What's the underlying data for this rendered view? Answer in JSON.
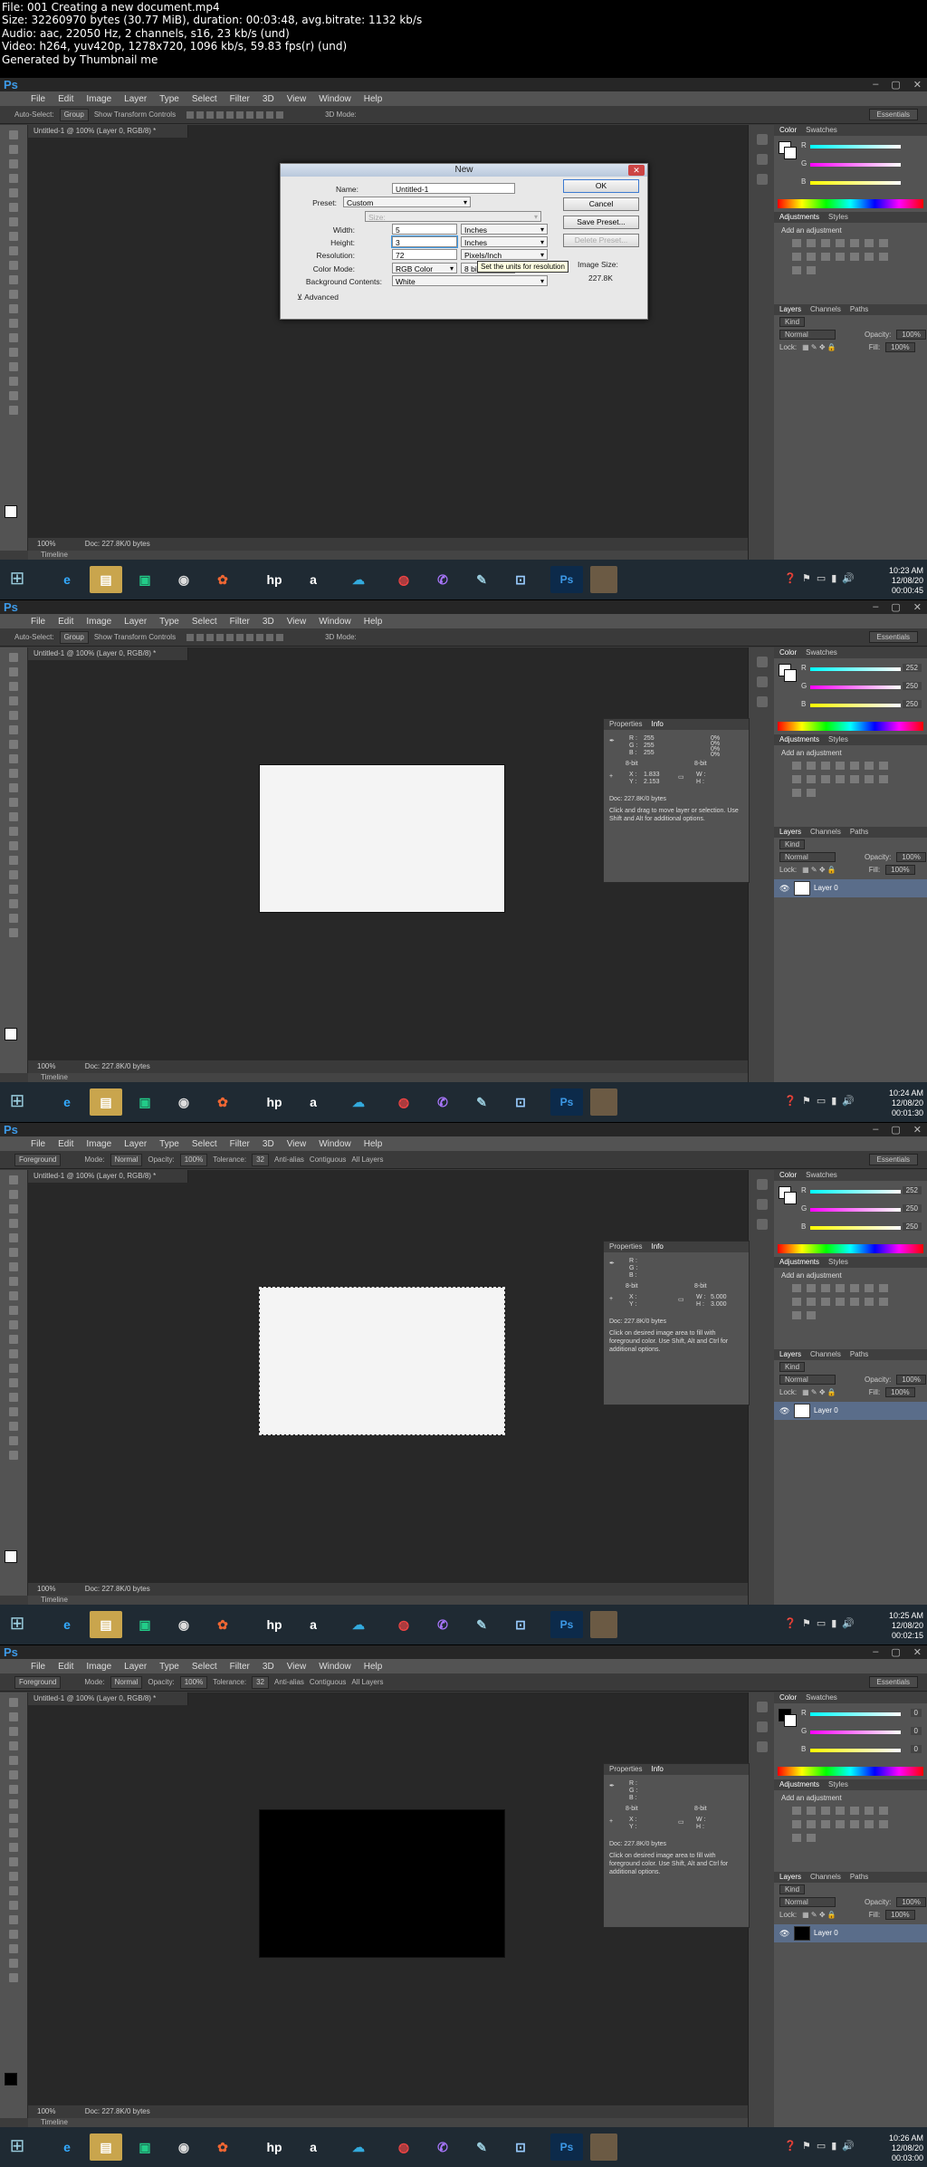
{
  "header": {
    "file": "File: 001 Creating a new document.mp4",
    "size": "Size: 32260970 bytes (30.77 MiB), duration: 00:03:48, avg.bitrate: 1132 kb/s",
    "audio": "Audio: aac, 22050 Hz, 2 channels, s16, 23 kb/s (und)",
    "video": "Video: h264, yuv420p, 1278x720, 1096 kb/s, 59.83 fps(r) (und)",
    "generator": "Generated by Thumbnail me"
  },
  "app": {
    "logo": "Ps",
    "menu": [
      "File",
      "Edit",
      "Image",
      "Layer",
      "Type",
      "Select",
      "Filter",
      "3D",
      "View",
      "Window",
      "Help"
    ],
    "workspace": "Essentials",
    "window_controls": [
      "–",
      "▢",
      "✕"
    ],
    "doc_tab": "Untitled-1 @ 100% (Layer 0, RGB/8) *",
    "status_zoom": "100%",
    "status_doc": "Doc: 227.8K/0 bytes",
    "timeline": "Timeline"
  },
  "optbar_move": {
    "auto_select": "Auto-Select:",
    "group": "Group",
    "show_transform": "Show Transform Controls",
    "mode3d": "3D Mode:"
  },
  "optbar_fill": {
    "fill": "Foreground",
    "mode_lbl": "Mode:",
    "mode": "Normal",
    "opacity_lbl": "Opacity:",
    "opacity": "100%",
    "tolerance_lbl": "Tolerance:",
    "tolerance": "32",
    "anti_alias": "Anti-alias",
    "contiguous": "Contiguous",
    "all_layers": "All Layers"
  },
  "panels": {
    "color_tabs": [
      "Color",
      "Swatches"
    ],
    "adj_tabs": [
      "Adjustments",
      "Styles"
    ],
    "adj_heading": "Add an adjustment",
    "layers_tabs": [
      "Layers",
      "Channels",
      "Paths"
    ],
    "kind": "Kind",
    "blend": "Normal",
    "opacity_lbl": "Opacity:",
    "opacity": "100%",
    "lock_lbl": "Lock:",
    "fill_lbl": "Fill:",
    "fill": "100%",
    "layer_name": "Layer 0",
    "info_tabs": [
      "Properties",
      "Info"
    ]
  },
  "frames": [
    {
      "timestamp": "00:00:45",
      "clock": "10:23 AM",
      "date": "12/08/20",
      "rgb": [
        "R",
        "G",
        "B"
      ],
      "rgb_vals": [
        "",
        "",
        ""
      ],
      "dialog": {
        "title": "New",
        "name_lbl": "Name:",
        "name": "Untitled-1",
        "preset_lbl": "Preset:",
        "preset": "Custom",
        "size_lbl": "Size:",
        "width_lbl": "Width:",
        "width": "5",
        "width_unit": "Inches",
        "height_lbl": "Height:",
        "height": "3",
        "height_unit": "Inches",
        "res_lbl": "Resolution:",
        "res": "72",
        "res_unit": "Pixels/Inch",
        "mode_lbl": "Color Mode:",
        "mode": "RGB Color",
        "bits": "8 bit",
        "bg_lbl": "Background Contents:",
        "bg": "White",
        "advanced": "Advanced",
        "ok": "OK",
        "cancel": "Cancel",
        "save_preset": "Save Preset...",
        "delete_preset": "Delete Preset...",
        "image_size_lbl": "Image Size:",
        "image_size": "227.8K",
        "tooltip": "Set the units for resolution"
      }
    },
    {
      "timestamp": "00:01:30",
      "clock": "10:24 AM",
      "date": "12/08/20",
      "rgb_vals": [
        "252",
        "250",
        "250"
      ],
      "info": {
        "r": "255",
        "g": "255",
        "b": "255",
        "c": "0%",
        "m": "0%",
        "y": "0%",
        "k": "0%",
        "bits": "8-bit",
        "x": "1.833",
        "yv": "2.153",
        "doc": "Doc: 227.8K/0 bytes",
        "hint": "Click and drag to move layer or selection. Use Shift and Alt for additional options."
      }
    },
    {
      "timestamp": "00:02:15",
      "clock": "10:25 AM",
      "date": "12/08/20",
      "rgb_vals": [
        "252",
        "250",
        "250"
      ],
      "info": {
        "w": "5.000",
        "h": "3.000",
        "bits": "8-bit",
        "doc": "Doc: 227.8K/0 bytes",
        "hint": "Click on desired image area to fill with foreground color. Use Shift, Alt and Ctrl for additional options."
      }
    },
    {
      "timestamp": "00:03:00",
      "clock": "10:26 AM",
      "date": "12/08/20",
      "rgb_vals": [
        "0",
        "0",
        "0"
      ],
      "info": {
        "bits": "8-bit",
        "doc": "Doc: 227.8K/0 bytes",
        "hint": "Click on desired image area to fill with foreground color. Use Shift, Alt and Ctrl for additional options."
      }
    }
  ],
  "colors": {
    "ps_blue": "#3d9ae8",
    "canvas_dark": "#282828",
    "selected_layer": "#5a6d8a"
  }
}
